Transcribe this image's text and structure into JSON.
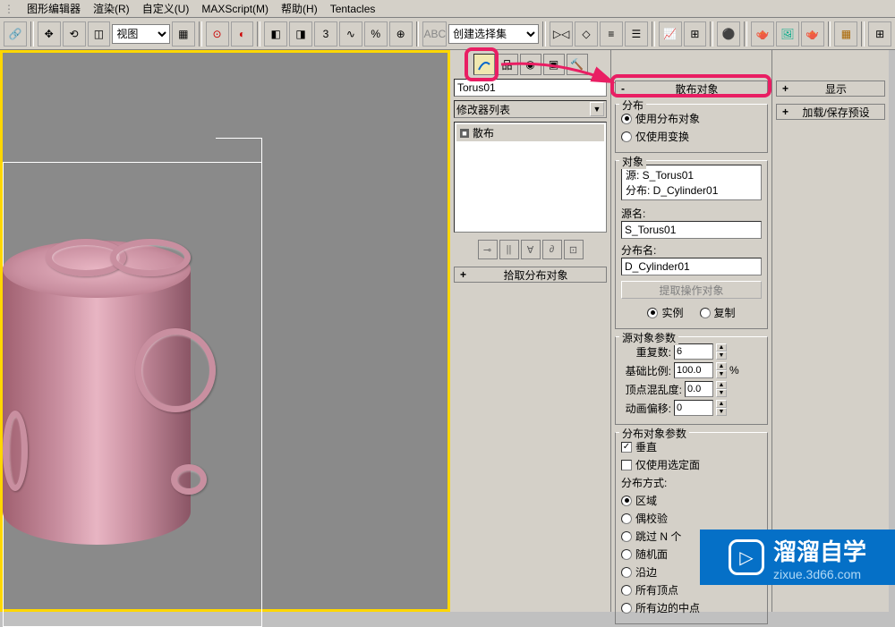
{
  "menu": {
    "items": [
      "图形编辑器",
      "渲染(R)",
      "自定义(U)",
      "MAXScript(M)",
      "帮助(H)",
      "Tentacles"
    ]
  },
  "toolbar": {
    "viewport_mode": "视图",
    "selection_set": "创建选择集"
  },
  "modifier_panel": {
    "object_name": "Torus01",
    "modifier_list_label": "修改器列表",
    "stack_item": "散布"
  },
  "left_rollout": {
    "pick_dist_label": "拾取分布对象"
  },
  "scatter_rollout": {
    "title": "散布对象",
    "dist_group": "分布",
    "use_dist_obj": "使用分布对象",
    "use_transform_only": "仅使用变换",
    "object_group": "对象",
    "source_line": "源:   S_Torus01",
    "dist_line": "分布: D_Cylinder01",
    "source_name_label": "源名:",
    "source_name_value": "S_Torus01",
    "dist_name_label": "分布名:",
    "dist_name_value": "D_Cylinder01",
    "extract_op_btn": "提取操作对象",
    "instance_label": "实例",
    "copy_label": "复制",
    "source_params_group": "源对象参数",
    "duplicates_label": "重复数:",
    "duplicates_value": "6",
    "base_scale_label": "基础比例:",
    "base_scale_value": "100.0",
    "vertex_chaos_label": "顶点混乱度:",
    "vertex_chaos_value": "0.0",
    "anim_offset_label": "动画偏移:",
    "anim_offset_value": "0",
    "percent": "%",
    "dist_params_group": "分布对象参数",
    "perpendicular": "垂直",
    "use_selected_faces": "仅使用选定面",
    "dist_method_label": "分布方式:",
    "methods": [
      "区域",
      "偶校验",
      "跳过 N 个",
      "随机面",
      "沿边",
      "所有顶点",
      "所有边的中点"
    ]
  },
  "far_panel": {
    "display_label": "显示",
    "load_save_label": "加载/保存预设"
  },
  "watermark": {
    "brand": "溜溜自学",
    "url": "zixue.3d66.com"
  }
}
